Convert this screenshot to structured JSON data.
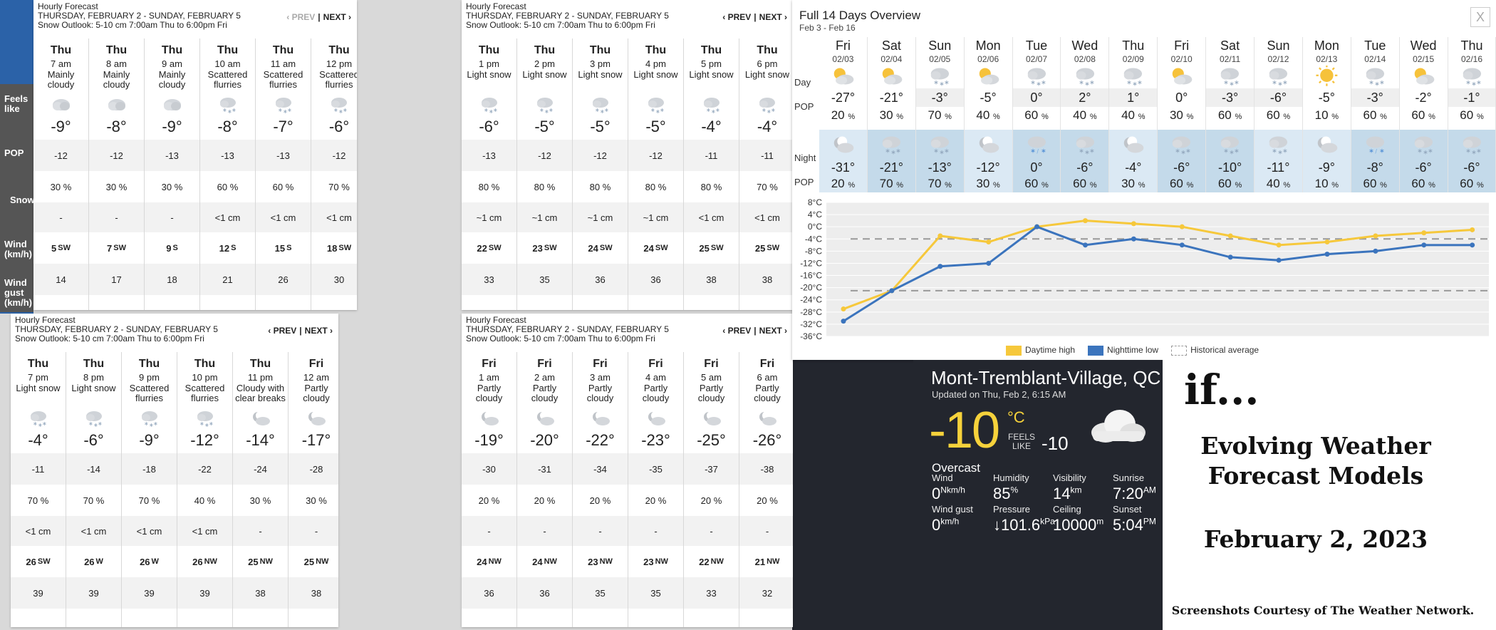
{
  "hourly_panels": [
    {
      "title": "Hourly Forecast",
      "range": "THURSDAY, FEBRUARY 2 - SUNDAY, FEBRUARY 5",
      "outlook": "Snow Outlook: 5-10 cm 7:00am Thu to 6:00pm Fri",
      "prev": "‹ PREV",
      "next": "NEXT ›",
      "prev_disabled": true,
      "hours": [
        {
          "day": "Thu",
          "time": "7 am",
          "cond": "Mainly cloudy",
          "icon": "cloudy-icon",
          "temp": "-9°",
          "feels": "-12",
          "pop": "30 %",
          "snow": "-",
          "wind": "5",
          "dir": "SW",
          "gust": "14"
        },
        {
          "day": "Thu",
          "time": "8 am",
          "cond": "Mainly cloudy",
          "icon": "cloudy-icon",
          "temp": "-8°",
          "feels": "-12",
          "pop": "30 %",
          "snow": "-",
          "wind": "7",
          "dir": "SW",
          "gust": "17"
        },
        {
          "day": "Thu",
          "time": "9 am",
          "cond": "Mainly cloudy",
          "icon": "cloudy-icon",
          "temp": "-9°",
          "feels": "-13",
          "pop": "30 %",
          "snow": "-",
          "wind": "9",
          "dir": "S",
          "gust": "18"
        },
        {
          "day": "Thu",
          "time": "10 am",
          "cond": "Scattered flurries",
          "icon": "snow-icon",
          "temp": "-8°",
          "feels": "-13",
          "pop": "60 %",
          "snow": "<1 cm",
          "wind": "12",
          "dir": "S",
          "gust": "21"
        },
        {
          "day": "Thu",
          "time": "11 am",
          "cond": "Scattered flurries",
          "icon": "snow-icon",
          "temp": "-7°",
          "feels": "-13",
          "pop": "60 %",
          "snow": "<1 cm",
          "wind": "15",
          "dir": "S",
          "gust": "26"
        },
        {
          "day": "Thu",
          "time": "12 pm",
          "cond": "Scattered flurries",
          "icon": "snow-icon",
          "temp": "-6°",
          "feels": "-12",
          "pop": "70 %",
          "snow": "<1 cm",
          "wind": "18",
          "dir": "SW",
          "gust": "30"
        }
      ]
    },
    {
      "title": "Hourly Forecast",
      "range": "THURSDAY, FEBRUARY 2 - SUNDAY, FEBRUARY 5",
      "outlook": "Snow Outlook: 5-10 cm 7:00am Thu to 6:00pm Fri",
      "prev": "‹ PREV",
      "next": "NEXT ›",
      "prev_disabled": false,
      "hours": [
        {
          "day": "Thu",
          "time": "1 pm",
          "cond": "Light snow",
          "icon": "snow-icon",
          "temp": "-6°",
          "feels": "-13",
          "pop": "80 %",
          "snow": "~1 cm",
          "wind": "22",
          "dir": "SW",
          "gust": "33"
        },
        {
          "day": "Thu",
          "time": "2 pm",
          "cond": "Light snow",
          "icon": "snow-icon",
          "temp": "-5°",
          "feels": "-12",
          "pop": "80 %",
          "snow": "~1 cm",
          "wind": "23",
          "dir": "SW",
          "gust": "35"
        },
        {
          "day": "Thu",
          "time": "3 pm",
          "cond": "Light snow",
          "icon": "snow-icon",
          "temp": "-5°",
          "feels": "-12",
          "pop": "80 %",
          "snow": "~1 cm",
          "wind": "24",
          "dir": "SW",
          "gust": "36"
        },
        {
          "day": "Thu",
          "time": "4 pm",
          "cond": "Light snow",
          "icon": "snow-icon",
          "temp": "-5°",
          "feels": "-12",
          "pop": "80 %",
          "snow": "~1 cm",
          "wind": "24",
          "dir": "SW",
          "gust": "36"
        },
        {
          "day": "Thu",
          "time": "5 pm",
          "cond": "Light snow",
          "icon": "snow-icon",
          "temp": "-4°",
          "feels": "-11",
          "pop": "80 %",
          "snow": "<1 cm",
          "wind": "25",
          "dir": "SW",
          "gust": "38"
        },
        {
          "day": "Thu",
          "time": "6 pm",
          "cond": "Light snow",
          "icon": "snow-icon",
          "temp": "-4°",
          "feels": "-11",
          "pop": "70 %",
          "snow": "<1 cm",
          "wind": "25",
          "dir": "SW",
          "gust": "38"
        }
      ]
    },
    {
      "title": "Hourly Forecast",
      "range": "THURSDAY, FEBRUARY 2 - SUNDAY, FEBRUARY 5",
      "outlook": "Snow Outlook: 5-10 cm 7:00am Thu to 6:00pm Fri",
      "prev": "‹ PREV",
      "next": "NEXT ›",
      "prev_disabled": false,
      "hours": [
        {
          "day": "Thu",
          "time": "7 pm",
          "cond": "Light snow",
          "icon": "snow-icon",
          "temp": "-4°",
          "feels": "-11",
          "pop": "70 %",
          "snow": "<1 cm",
          "wind": "26",
          "dir": "SW",
          "gust": "39"
        },
        {
          "day": "Thu",
          "time": "8 pm",
          "cond": "Light snow",
          "icon": "snow-icon",
          "temp": "-6°",
          "feels": "-14",
          "pop": "70 %",
          "snow": "<1 cm",
          "wind": "26",
          "dir": "W",
          "gust": "39"
        },
        {
          "day": "Thu",
          "time": "9 pm",
          "cond": "Scattered flurries",
          "icon": "snow-icon",
          "temp": "-9°",
          "feels": "-18",
          "pop": "70 %",
          "snow": "<1 cm",
          "wind": "26",
          "dir": "W",
          "gust": "39"
        },
        {
          "day": "Thu",
          "time": "10 pm",
          "cond": "Scattered flurries",
          "icon": "snow-icon",
          "temp": "-12°",
          "feels": "-22",
          "pop": "40 %",
          "snow": "<1 cm",
          "wind": "26",
          "dir": "NW",
          "gust": "39"
        },
        {
          "day": "Thu",
          "time": "11 pm",
          "cond": "Cloudy with clear breaks",
          "icon": "moon-cloud-icon",
          "temp": "-14°",
          "feels": "-24",
          "pop": "30 %",
          "snow": "-",
          "wind": "25",
          "dir": "NW",
          "gust": "38"
        },
        {
          "day": "Fri",
          "time": "12 am",
          "cond": "Partly cloudy",
          "icon": "moon-cloud-icon",
          "temp": "-17°",
          "feels": "-28",
          "pop": "30 %",
          "snow": "-",
          "wind": "25",
          "dir": "NW",
          "gust": "38"
        }
      ]
    },
    {
      "title": "Hourly Forecast",
      "range": "THURSDAY, FEBRUARY 2 - SUNDAY, FEBRUARY 5",
      "outlook": "Snow Outlook: 5-10 cm 7:00am Thu to 6:00pm Fri",
      "prev": "‹ PREV",
      "next": "NEXT ›",
      "prev_disabled": false,
      "hours": [
        {
          "day": "Fri",
          "time": "1 am",
          "cond": "Partly cloudy",
          "icon": "moon-cloud-icon",
          "temp": "-19°",
          "feels": "-30",
          "pop": "20 %",
          "snow": "-",
          "wind": "24",
          "dir": "NW",
          "gust": "36"
        },
        {
          "day": "Fri",
          "time": "2 am",
          "cond": "Partly cloudy",
          "icon": "moon-cloud-icon",
          "temp": "-20°",
          "feels": "-31",
          "pop": "20 %",
          "snow": "-",
          "wind": "24",
          "dir": "NW",
          "gust": "36"
        },
        {
          "day": "Fri",
          "time": "3 am",
          "cond": "Partly cloudy",
          "icon": "moon-cloud-icon",
          "temp": "-22°",
          "feels": "-34",
          "pop": "20 %",
          "snow": "-",
          "wind": "23",
          "dir": "NW",
          "gust": "35"
        },
        {
          "day": "Fri",
          "time": "4 am",
          "cond": "Partly cloudy",
          "icon": "moon-cloud-icon",
          "temp": "-23°",
          "feels": "-35",
          "pop": "20 %",
          "snow": "-",
          "wind": "23",
          "dir": "NW",
          "gust": "35"
        },
        {
          "day": "Fri",
          "time": "5 am",
          "cond": "Partly cloudy",
          "icon": "moon-cloud-icon",
          "temp": "-25°",
          "feels": "-37",
          "pop": "20 %",
          "snow": "-",
          "wind": "22",
          "dir": "NW",
          "gust": "33"
        },
        {
          "day": "Fri",
          "time": "6 am",
          "cond": "Partly cloudy",
          "icon": "moon-cloud-icon",
          "temp": "-26°",
          "feels": "-38",
          "pop": "20 %",
          "snow": "-",
          "wind": "21",
          "dir": "NW",
          "gust": "32"
        }
      ]
    }
  ],
  "side_labels": {
    "feels": "Feels like",
    "pop": "POP",
    "snow": "Snow",
    "wind": "Wind (km/h)",
    "gust": "Wind gust (km/h)"
  },
  "overview": {
    "title": "Full 14 Days Overview",
    "range": "Feb 3 - Feb 16",
    "close": "X",
    "row_labels": {
      "day": "Day",
      "pop": "POP",
      "night": "Night",
      "npop": "POP"
    },
    "days": [
      {
        "day": "Fri",
        "date": "02/03",
        "dicon": "sun-cloud-icon",
        "high": "-27°",
        "dpop": "20",
        "nicon": "moon-cloud-icon",
        "low": "-31°",
        "npop": "20"
      },
      {
        "day": "Sat",
        "date": "02/04",
        "dicon": "sun-cloud-icon",
        "high": "-21°",
        "dpop": "30",
        "nicon": "snow-icon",
        "low": "-21°",
        "npop": "70"
      },
      {
        "day": "Sun",
        "date": "02/05",
        "dicon": "snow-icon",
        "high": "-3°",
        "dpop": "70",
        "nicon": "snow-icon",
        "low": "-13°",
        "npop": "70"
      },
      {
        "day": "Mon",
        "date": "02/06",
        "dicon": "sun-cloud-icon",
        "high": "-5°",
        "dpop": "40",
        "nicon": "moon-cloud-icon",
        "low": "-12°",
        "npop": "30"
      },
      {
        "day": "Tue",
        "date": "02/07",
        "dicon": "snow-icon",
        "high": "0°",
        "dpop": "60",
        "nicon": "mixed-icon",
        "low": "0°",
        "npop": "60"
      },
      {
        "day": "Wed",
        "date": "02/08",
        "dicon": "snow-icon",
        "high": "2°",
        "dpop": "40",
        "nicon": "snow-icon",
        "low": "-6°",
        "npop": "60"
      },
      {
        "day": "Thu",
        "date": "02/09",
        "dicon": "snow-icon",
        "high": "1°",
        "dpop": "40",
        "nicon": "moon-cloud-icon",
        "low": "-4°",
        "npop": "30"
      },
      {
        "day": "Fri",
        "date": "02/10",
        "dicon": "sun-cloud-icon",
        "high": "0°",
        "dpop": "30",
        "nicon": "snow-icon",
        "low": "-6°",
        "npop": "60"
      },
      {
        "day": "Sat",
        "date": "02/11",
        "dicon": "snow-icon",
        "high": "-3°",
        "dpop": "60",
        "nicon": "snow-icon",
        "low": "-10°",
        "npop": "60"
      },
      {
        "day": "Sun",
        "date": "02/12",
        "dicon": "snow-icon",
        "high": "-6°",
        "dpop": "60",
        "nicon": "snow-icon",
        "low": "-11°",
        "npop": "40"
      },
      {
        "day": "Mon",
        "date": "02/13",
        "dicon": "sun-icon",
        "high": "-5°",
        "dpop": "10",
        "nicon": "moon-cloud-icon",
        "low": "-9°",
        "npop": "10"
      },
      {
        "day": "Tue",
        "date": "02/14",
        "dicon": "snow-icon",
        "high": "-3°",
        "dpop": "60",
        "nicon": "mixed-icon",
        "low": "-8°",
        "npop": "60"
      },
      {
        "day": "Wed",
        "date": "02/15",
        "dicon": "sun-cloud-icon",
        "high": "-2°",
        "dpop": "60",
        "nicon": "snow-icon",
        "low": "-6°",
        "npop": "60"
      },
      {
        "day": "Thu",
        "date": "02/16",
        "dicon": "snow-icon",
        "high": "-1°",
        "dpop": "60",
        "nicon": "snow-icon",
        "low": "-6°",
        "npop": "60"
      }
    ],
    "pct": "%",
    "legend": {
      "high": "Daytime high",
      "low": "Nighttime low",
      "hist": "Historical average"
    },
    "colors": {
      "high": "#f6c83b",
      "low": "#3b74bd",
      "hist": "#aaaaaa"
    }
  },
  "chart_data": {
    "type": "line",
    "x": [
      "02/03",
      "02/04",
      "02/05",
      "02/06",
      "02/07",
      "02/08",
      "02/09",
      "02/10",
      "02/11",
      "02/12",
      "02/13",
      "02/14",
      "02/15",
      "02/16"
    ],
    "series": [
      {
        "name": "Daytime high",
        "values": [
          -27,
          -21,
          -3,
          -5,
          0,
          2,
          1,
          0,
          -3,
          -6,
          -5,
          -3,
          -2,
          -1
        ]
      },
      {
        "name": "Nighttime low",
        "values": [
          -31,
          -21,
          -13,
          -12,
          0,
          -6,
          -4,
          -6,
          -10,
          -11,
          -9,
          -8,
          -6,
          -6
        ]
      },
      {
        "name": "Historical average",
        "values": [
          -4,
          -21
        ]
      }
    ],
    "y_ticks": [
      "8°C",
      "4°C",
      "0°C",
      "-4°C",
      "-8°C",
      "-12°C",
      "-16°C",
      "-20°C",
      "-24°C",
      "-28°C",
      "-32°C",
      "-36°C"
    ],
    "ylim": [
      -36,
      8
    ],
    "legend_position": "bottom"
  },
  "current": {
    "city": "Mont-Tremblant-Village, QC",
    "updated": "Updated on Thu, Feb 2, 6:15 AM",
    "temp": "-10",
    "unit": "°C",
    "feels_label": "FEELS LIKE",
    "feels": "-10",
    "condition": "Overcast",
    "icon": "cloudy-icon",
    "stats": [
      {
        "label": "Wind",
        "value": "0",
        "unit": "km/h",
        "dir": "N"
      },
      {
        "label": "Humidity",
        "value": "85",
        "unit": "%"
      },
      {
        "label": "Visibility",
        "value": "14",
        "unit": "km"
      },
      {
        "label": "Sunrise",
        "value": "7:20",
        "unit": "AM"
      },
      {
        "label": "Wind gust",
        "value": "0",
        "unit": "km/h"
      },
      {
        "label": "Pressure",
        "value": "↓101.6",
        "unit": "kPa"
      },
      {
        "label": "Ceiling",
        "value": "10000",
        "unit": "m"
      },
      {
        "label": "Sunset",
        "value": "5:04",
        "unit": "PM"
      }
    ]
  },
  "note": {
    "if": "if...",
    "headline": "Evolving Weather Forecast Models",
    "date": "February 2, 2023",
    "credit": "Screenshots Courtesy of The Weather Network."
  }
}
